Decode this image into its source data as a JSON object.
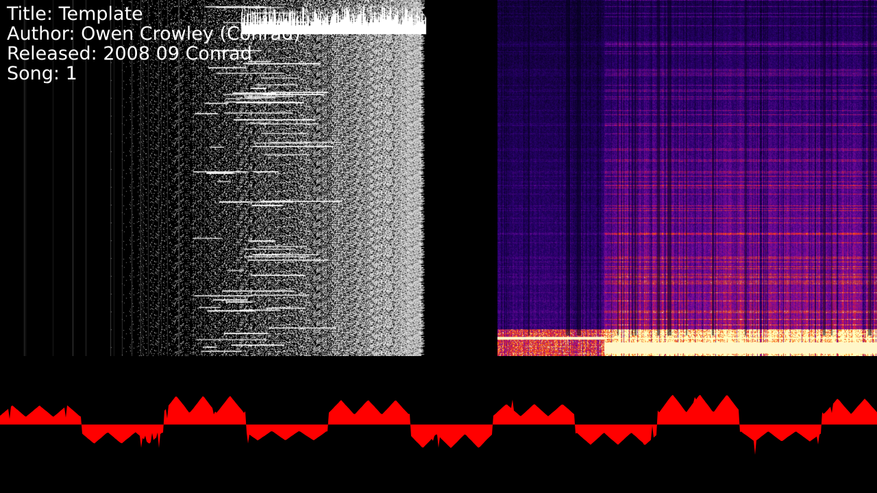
{
  "song_info": {
    "title_label": "Title:",
    "title_value": "Template",
    "author_label": "Author:",
    "author_value": "Owen Crowley (Conrad)",
    "released_label": "Released:",
    "released_value": "2008 09 Conrad",
    "song_label": "Song:",
    "song_value": "1"
  },
  "colors": {
    "background": "#000000",
    "channel_scope": "#ffffff",
    "spectrogram_low": "#04001a",
    "spectrogram_mid": "#6a00a8",
    "spectrogram_high": "#ff2a00",
    "spectrogram_peak": "#ffffc0",
    "waveform": "#ff0000"
  }
}
